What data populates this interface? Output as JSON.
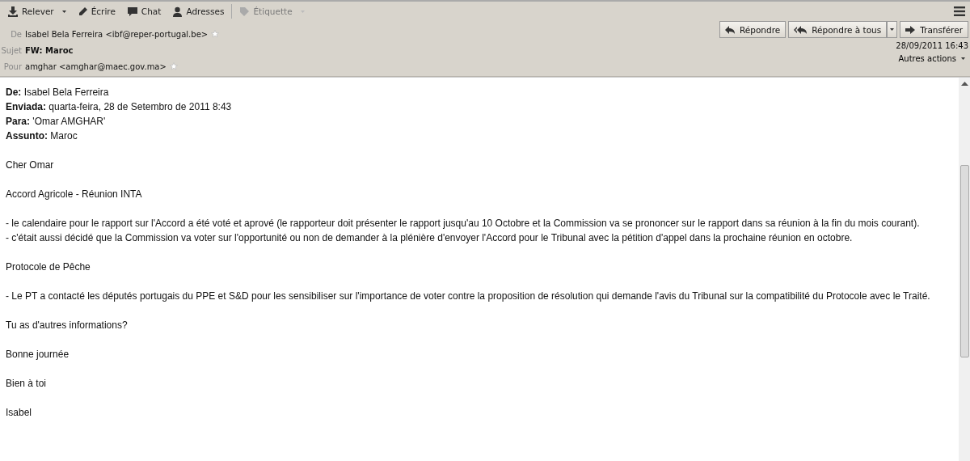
{
  "toolbar": [
    {
      "label": "Relever",
      "kind": "download",
      "dropdown": true,
      "disabled": false
    },
    {
      "label": "Écrire",
      "kind": "pencil",
      "dropdown": false,
      "disabled": false
    },
    {
      "label": "Chat",
      "kind": "chat",
      "dropdown": false,
      "disabled": false
    },
    {
      "label": "Adresses",
      "kind": "person",
      "dropdown": false,
      "disabled": false
    },
    {
      "label": "Étiquette",
      "kind": "tag",
      "dropdown": true,
      "disabled": true
    }
  ],
  "header_fields": [
    {
      "label": "De",
      "value": "Isabel Bela Ferreira <ibf@reper-portugal.be>",
      "bold": false,
      "star": true
    },
    {
      "label": "Sujet",
      "value": "FW: Maroc",
      "bold": true,
      "star": false
    },
    {
      "label": "Pour",
      "value": "amghar <amghar@maec.gov.ma>",
      "bold": false,
      "star": true
    }
  ],
  "actions": [
    {
      "label": "Répondre",
      "kind": "reply",
      "dropdown": false
    },
    {
      "label": "Répondre à tous",
      "kind": "reply-all",
      "dropdown": true
    },
    {
      "label": "Transférer",
      "kind": "forward",
      "dropdown": false
    }
  ],
  "date": "28/09/2011 16:43",
  "more_actions": "Autres actions",
  "body": [
    [
      "**De:** Isabel Bela Ferreira",
      "**Enviada:** quarta-feira, 28 de Setembro de 2011 8:43",
      "**Para:** 'Omar AMGHAR'",
      "**Assunto:** Maroc"
    ],
    [
      "Cher Omar"
    ],
    [
      "Accord Agricole - Réunion INTA"
    ],
    [
      "- le calendaire pour le rapport sur l'Accord a été voté et aprové (le rapporteur doit présenter le rapport jusqu'au 10 Octobre et la Commission va se prononcer sur le rapport dans sa réunion à la fin du mois courant).",
      "- c'était aussi décidé que la Commission va voter sur l'opportunité ou non de demander à la plénière d'envoyer l'Accord pour le Tribunal avec la pétition d'appel dans la prochaine réunion en octobre."
    ],
    [
      "Protocole de Pêche"
    ],
    [
      "- Le PT a contacté les députés portugais du PPE et S&D pour les sensibiliser sur l'importance de voter contre la proposition de résolution qui demande l'avis du Tribunal sur la compatibilité du Protocole avec le Traité."
    ],
    [
      "Tu as d'autres informations?"
    ],
    [
      "Bonne journée"
    ],
    [
      "Bien à toi"
    ],
    [
      "Isabel"
    ]
  ]
}
